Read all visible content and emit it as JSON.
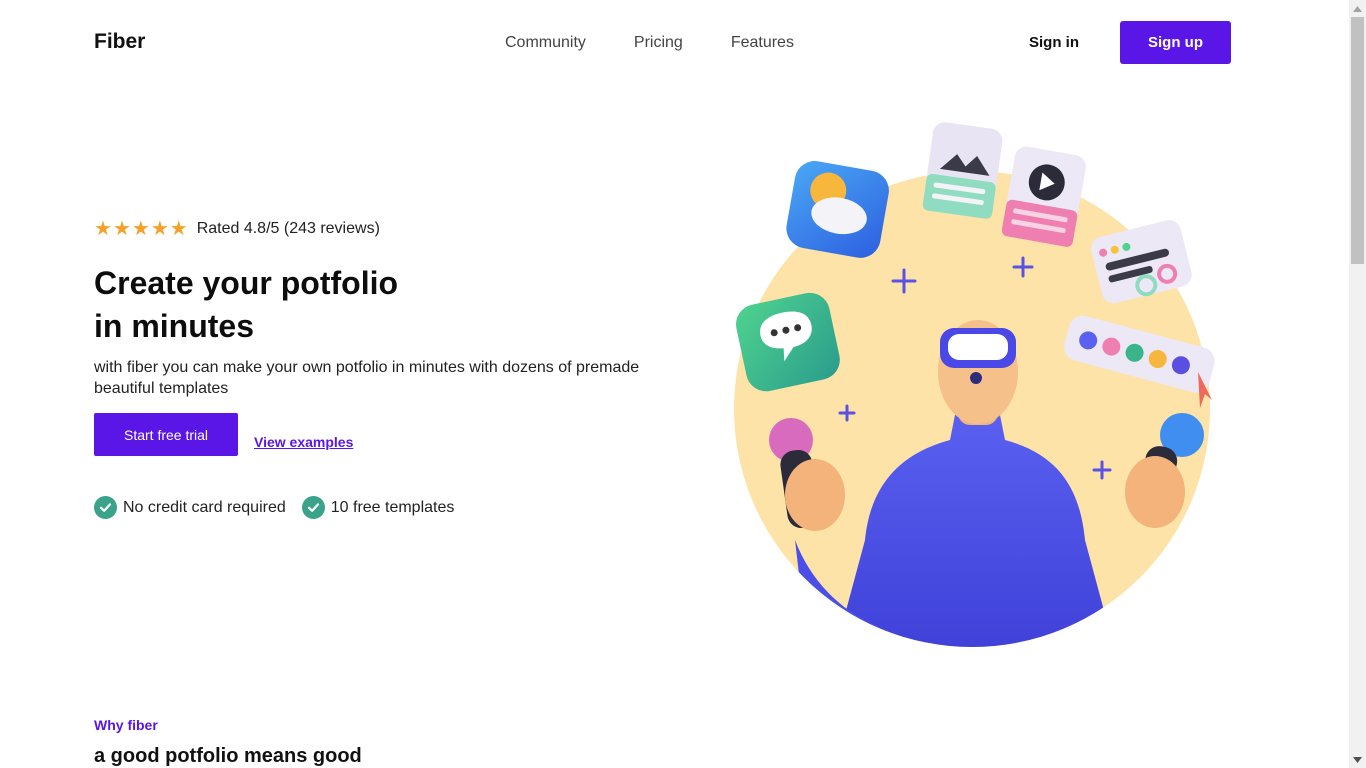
{
  "nav": {
    "brand": "Fiber",
    "links": [
      "Community",
      "Pricing",
      "Features"
    ],
    "signin": "Sign in",
    "signup": "Sign up"
  },
  "hero": {
    "rating_value": 4.8,
    "rating_text": "Rated 4.8/5 (243 reviews)",
    "headline_line1": "Create your potfolio",
    "headline_line2": "in minutes",
    "subtext": "with fiber you can make your own potfolio in minutes with dozens of premade beautiful templates",
    "cta": "Start free trial",
    "examples": "View examples",
    "checks": [
      "No credit card required",
      "10 free templates"
    ]
  },
  "why": {
    "eyebrow": "Why fiber",
    "title": "a good potfolio means good"
  },
  "colors": {
    "accent": "#5a16e6",
    "star": "#f4a12a",
    "check": "#3aa38a",
    "circle_bg": "#fde3a7"
  }
}
